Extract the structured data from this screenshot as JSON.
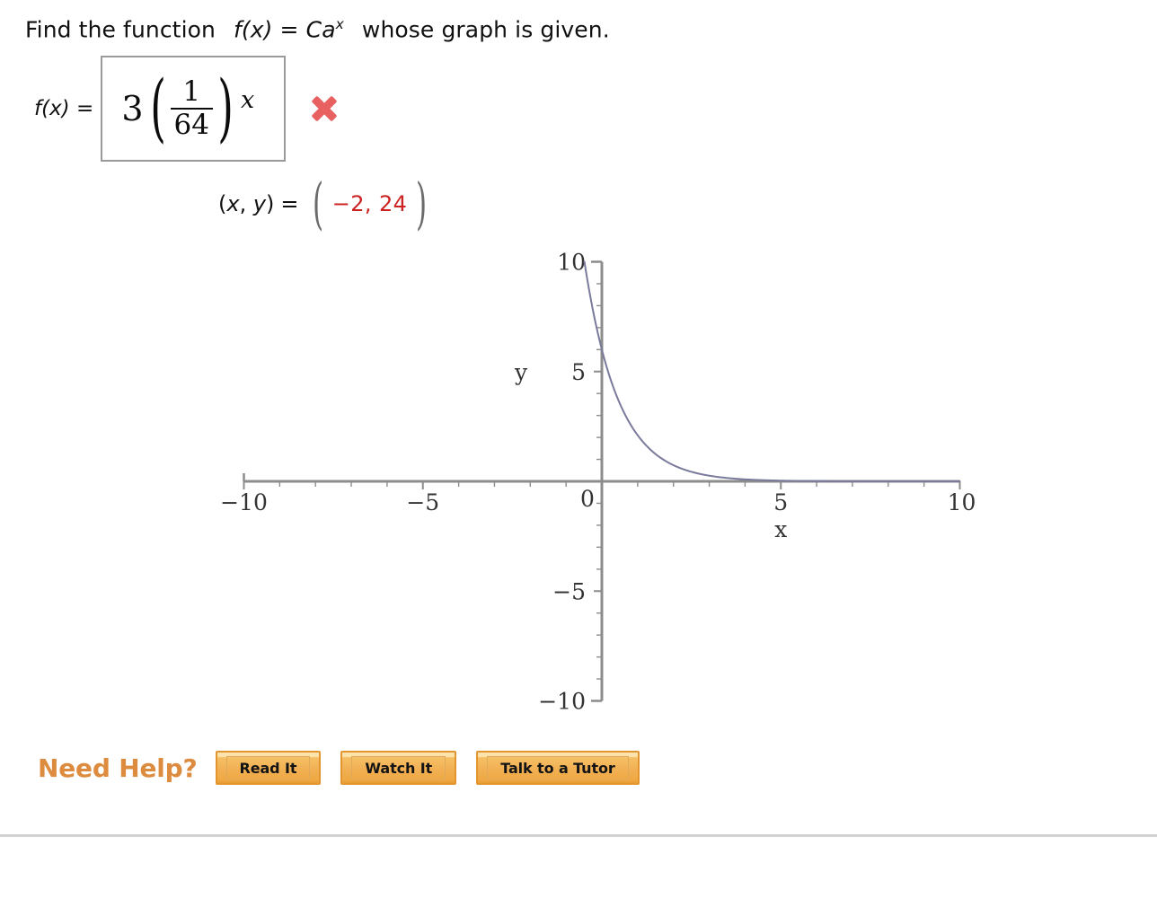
{
  "question": {
    "text_before": "Find the function",
    "function_expr": "f(x)",
    "equals": "=",
    "form_base": "Ca",
    "form_exponent": "x",
    "text_after": "whose graph is given."
  },
  "answer": {
    "label_fx": "f(x)",
    "label_eq": "=",
    "value": {
      "coefficient": "3",
      "left_paren": "(",
      "numerator": "1",
      "denominator": "64",
      "right_paren": ")",
      "exponent": "x"
    },
    "status_icon": "incorrect-x-icon",
    "status_color": "#e8605f"
  },
  "coordinate": {
    "label_open": "(",
    "label_x": "x",
    "label_comma": ", ",
    "label_y": "y",
    "label_close": ")",
    "equals": "=",
    "paren_left": "(",
    "paren_right": ")",
    "values": "−2, 24",
    "value_color": "#cc2222"
  },
  "chart_data": {
    "type": "line",
    "title": "",
    "xlabel": "x",
    "ylabel": "y",
    "xlim": [
      -10,
      10
    ],
    "ylim": [
      -10,
      10
    ],
    "grid": false,
    "legend": null,
    "x_ticks": [
      -10,
      -5,
      0,
      5,
      10
    ],
    "x_tick_labels": [
      "−10",
      "−5",
      "0",
      "5",
      "10"
    ],
    "y_ticks": [
      -10,
      -5,
      5,
      10
    ],
    "y_tick_labels": [
      "−10",
      "−5",
      "5",
      "10"
    ],
    "minor_tick_step": 1,
    "curve_color": "#7a7a9c",
    "axis_color": "#8c8c8c",
    "series": [
      {
        "name": "f(x)",
        "description": "decaying exponential through (0, 6)",
        "y_intercept": 6,
        "decay_base": 0.35,
        "x": [
          -0.34,
          -0.2,
          0,
          0.25,
          0.5,
          0.75,
          1,
          1.25,
          1.5,
          1.75,
          2,
          2.5,
          3,
          3.5,
          4,
          4.5,
          5,
          6,
          7,
          8,
          9,
          10
        ],
        "y": [
          10.0,
          8.1,
          6.0,
          4.58,
          3.55,
          2.74,
          2.1,
          1.62,
          1.25,
          0.96,
          0.74,
          0.44,
          0.26,
          0.15,
          0.09,
          0.055,
          0.032,
          0.011,
          0.004,
          0.0014,
          0.0005,
          0.0002
        ]
      }
    ]
  },
  "help": {
    "title": "Need Help?",
    "buttons": [
      {
        "label": "Read It"
      },
      {
        "label": "Watch It"
      },
      {
        "label": "Talk to a Tutor"
      }
    ]
  }
}
